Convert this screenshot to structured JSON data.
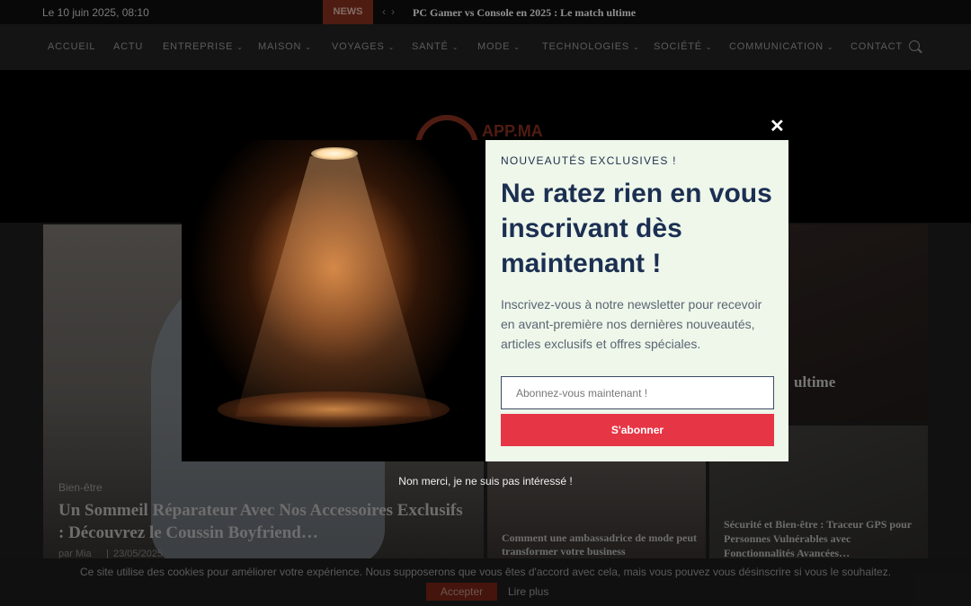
{
  "topbar": {
    "date": "Le 10 juin 2025, 08:10",
    "news_label": "NEWS",
    "ticker": "PC Gamer vs Console en 2025 : Le match ultime"
  },
  "nav": {
    "items": [
      "ACCUEIL",
      "ACTU",
      "ENTREPRISE",
      "MAISON",
      "VOYAGES",
      "SANTÉ",
      "MODE",
      "TECHNOLOGIES",
      "SOCIÉTÉ",
      "COMMUNICATION",
      "CONTACT"
    ]
  },
  "logo": {
    "text": "APP.MA"
  },
  "cards": {
    "big": {
      "category": "Bien-être",
      "title": "Un Sommeil Réparateur Avec Nos Accessoires Exclusifs : Découvrez le Coussin Boyfriend…",
      "author": "par Mia",
      "date": "23/05/2025"
    },
    "r1": {
      "title_fragment": "ultime"
    },
    "mid": {
      "title": "Comment une ambassadrice de mode peut transformer votre business"
    },
    "r2": {
      "title": "Sécurité et Bien-être : Traceur GPS pour Personnes Vulnérables avec Fonctionnalités Avancées…"
    }
  },
  "popup": {
    "eyebrow": "NOUVEAUTÉS EXCLUSIVES !",
    "headline": "Ne ratez rien en vous inscrivant dès maintenant !",
    "description": "Inscrivez-vous à notre newsletter pour recevoir en avant-première nos dernières nouveautés, articles exclusifs et offres spéciales.",
    "email_placeholder": "Abonnez-vous maintenant !",
    "subscribe_label": "S'abonner",
    "close_label": "✕",
    "no_thanks": "Non merci, je ne suis pas intéressé !"
  },
  "cookie": {
    "message": "Ce site utilise des cookies pour améliorer votre expérience. Nous supposerons que vous êtes d'accord avec cela, mais vous pouvez vous désinscrire si vous le souhaitez.",
    "accept_label": "Accepter",
    "more_label": "Lire plus"
  },
  "colors": {
    "accent_red": "#e63646",
    "navy": "#1c2f52",
    "popup_bg": "#eef7ea",
    "brand": "#7a2b1c"
  }
}
